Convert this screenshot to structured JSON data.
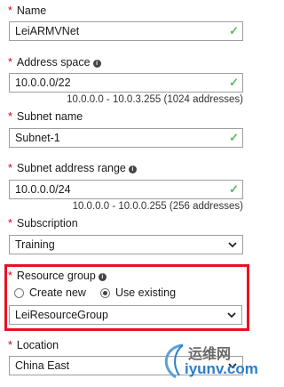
{
  "name": {
    "label": "Name",
    "value": "LeiARMVNet"
  },
  "address_space": {
    "label": "Address space",
    "value": "10.0.0.0/22",
    "hint": "10.0.0.0 - 10.0.3.255 (1024 addresses)"
  },
  "subnet_name": {
    "label": "Subnet name",
    "value": "Subnet-1"
  },
  "subnet_range": {
    "label": "Subnet address range",
    "value": "10.0.0.0/24",
    "hint": "10.0.0.0 - 10.0.0.255 (256 addresses)"
  },
  "subscription": {
    "label": "Subscription",
    "value": "Training"
  },
  "resource_group": {
    "label": "Resource group",
    "option_new": "Create new",
    "option_existing": "Use existing",
    "selected": "Use existing",
    "value": "LeiResourceGroup"
  },
  "location": {
    "label": "Location",
    "value": "China East"
  },
  "required_mark": "*",
  "info_glyph": "i",
  "check_glyph": "✓",
  "watermark": {
    "cn": "运维网",
    "en": "iyunv.com"
  },
  "colors": {
    "required": "#d0021b",
    "valid": "#5cb85c",
    "highlight": "#e81123"
  }
}
